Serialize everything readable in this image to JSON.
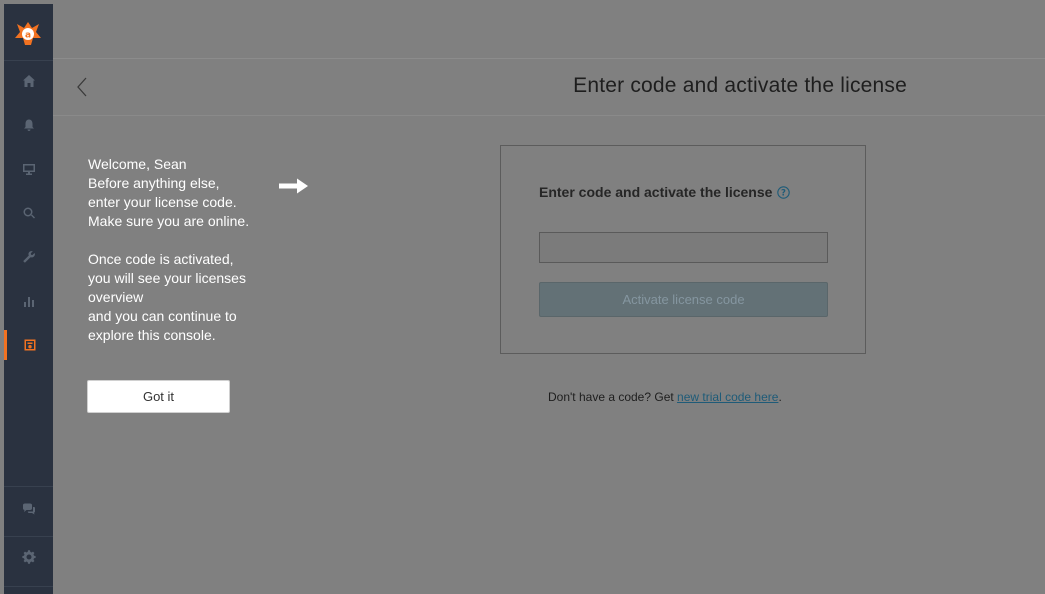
{
  "header": {
    "title": "Enter code and activate the license"
  },
  "welcome": {
    "line1": "Welcome, Sean",
    "line2": "Before anything else,",
    "line3": "enter your license code.",
    "line4": "Make sure you are online.",
    "line5": "Once code is activated,",
    "line6": "you will see your licenses",
    "line7": "overview",
    "line8": "and you can continue to",
    "line9": "explore this console.",
    "got_it_label": "Got it"
  },
  "card": {
    "title": "Enter code and activate the license",
    "input_value": "",
    "button_label": "Activate license code"
  },
  "trial": {
    "prefix": "Don't have a code? Get ",
    "link": "new trial code here",
    "suffix": "."
  },
  "sidebar": {
    "items": [
      {
        "icon": "home-icon"
      },
      {
        "icon": "bell-icon"
      },
      {
        "icon": "monitor-icon"
      },
      {
        "icon": "search-icon"
      },
      {
        "icon": "wrench-icon"
      },
      {
        "icon": "bar-chart-icon"
      },
      {
        "icon": "license-icon",
        "active": true
      },
      {
        "icon": "chat-icon"
      },
      {
        "icon": "gear-icon"
      }
    ]
  },
  "colors": {
    "accent": "#f27221",
    "sidebar": "#2a3240",
    "overlay": "#808080"
  }
}
